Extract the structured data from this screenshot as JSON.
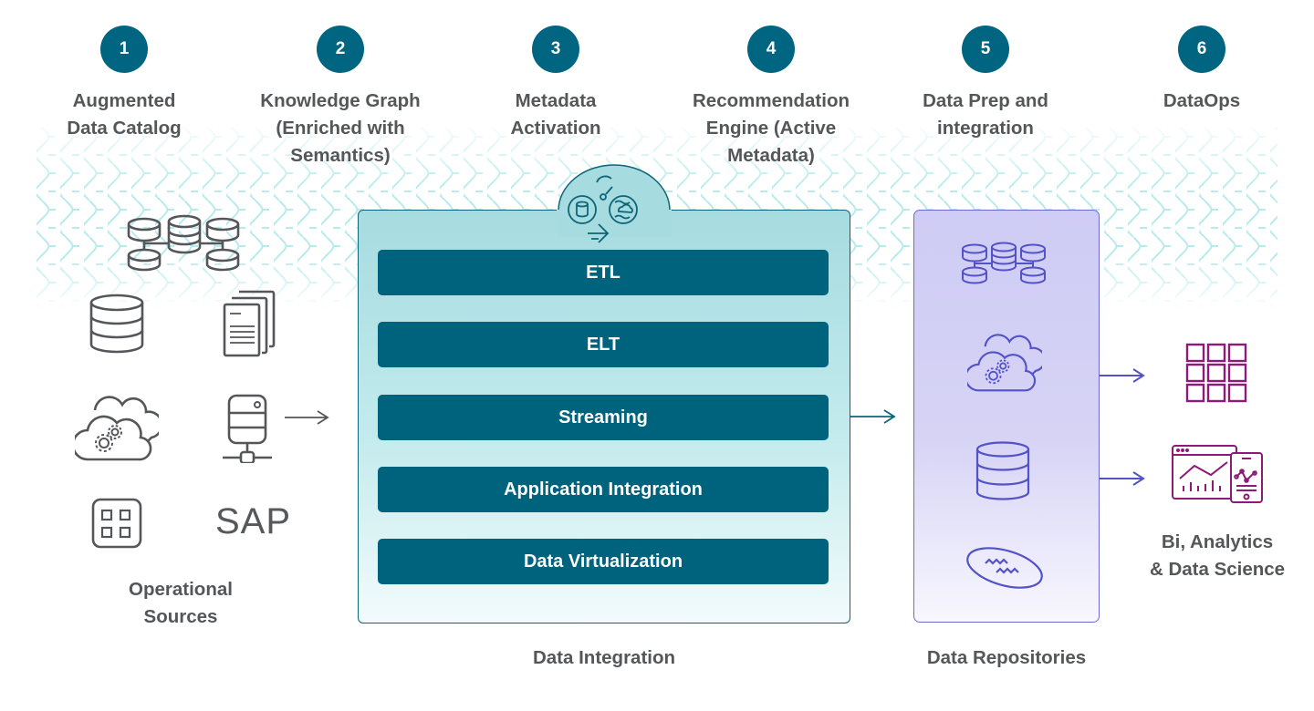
{
  "steps": [
    {
      "number": "1",
      "label": "Augmented\nData Catalog"
    },
    {
      "number": "2",
      "label": "Knowledge Graph\n(Enriched with\nSemantics)"
    },
    {
      "number": "3",
      "label": "Metadata\nActivation"
    },
    {
      "number": "4",
      "label": "Recommendation\nEngine (Active\nMetadata)"
    },
    {
      "number": "5",
      "label": "Data Prep and\nintegration"
    },
    {
      "number": "6",
      "label": "DataOps"
    }
  ],
  "operational_sources": {
    "label": "Operational\nSources",
    "icons": [
      "distributed-database-icon",
      "database-icon",
      "documents-icon",
      "cloud-gears-icon",
      "server-network-icon",
      "app-grid-icon"
    ],
    "sap_label": "SAP"
  },
  "data_integration": {
    "label": "Data Integration",
    "header_icon": "metadata-activation-icon",
    "items": [
      "ETL",
      "ELT",
      "Streaming",
      "Application Integration",
      "Data Virtualization"
    ]
  },
  "data_repositories": {
    "label": "Data Repositories",
    "icons": [
      "distributed-database-icon",
      "cloud-gears-icon",
      "database-icon",
      "data-lake-icon"
    ]
  },
  "consumers": {
    "label": "Bi, Analytics\n& Data Science",
    "icons": [
      "grid-table-icon",
      "analytics-dashboard-icon"
    ]
  },
  "colors": {
    "step_circle": "#006580",
    "integration_item": "#00637e",
    "integration_border": "#0d6577",
    "repository_border": "#6c6bd6",
    "consumer_icon": "#8e1a78",
    "source_icon": "#55565a",
    "wave": "#9fe3e6"
  }
}
